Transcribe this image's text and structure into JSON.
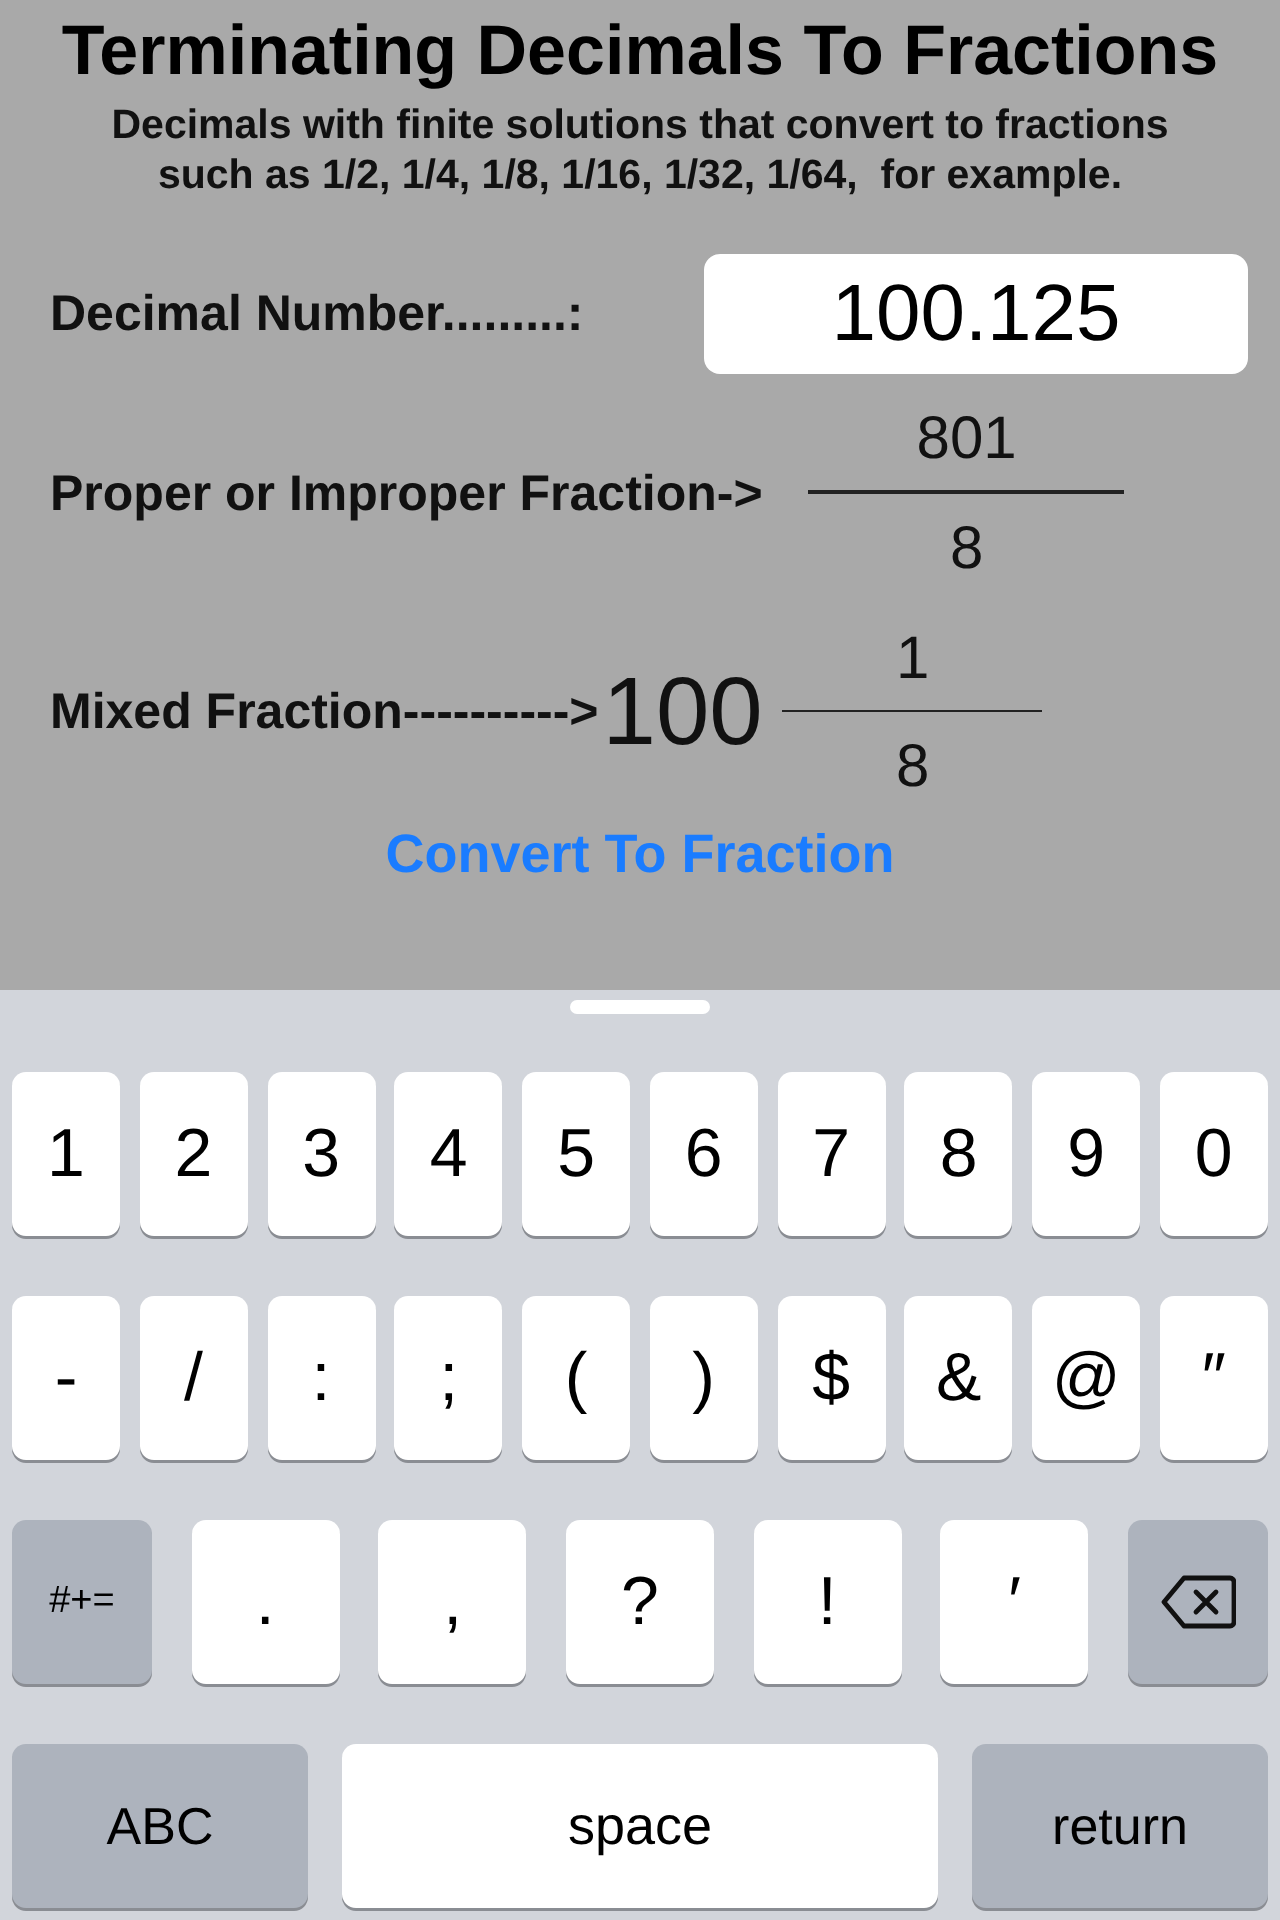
{
  "title": "Terminating Decimals To Fractions",
  "subtitle": [
    "Decimals with finite solutions that convert to fractions",
    "such as 1/2, 1/4, 1/8, 1/16, 1/32, 1/64,  for example."
  ],
  "decimal": {
    "label": "Decimal Number.........:",
    "value": "100.125"
  },
  "improper": {
    "label": "Proper or Improper Fraction->",
    "numerator": "801",
    "denominator": "8"
  },
  "mixed": {
    "label": "Mixed Fraction---------->",
    "whole": "100",
    "numerator": "1",
    "denominator": "8"
  },
  "convert_button": "Convert To Fraction",
  "keyboard": {
    "number_row": [
      {
        "kind": "char",
        "label": "1"
      },
      {
        "kind": "char",
        "label": "2"
      },
      {
        "kind": "char",
        "label": "3"
      },
      {
        "kind": "char",
        "label": "4"
      },
      {
        "kind": "char",
        "label": "5"
      },
      {
        "kind": "char",
        "label": "6"
      },
      {
        "kind": "char",
        "label": "7"
      },
      {
        "kind": "char",
        "label": "8"
      },
      {
        "kind": "char",
        "label": "9"
      },
      {
        "kind": "char",
        "label": "0"
      }
    ],
    "symbol_row": [
      {
        "kind": "char",
        "label": "-"
      },
      {
        "kind": "char",
        "label": "/"
      },
      {
        "kind": "char",
        "label": ":"
      },
      {
        "kind": "char",
        "label": ";"
      },
      {
        "kind": "char",
        "label": "("
      },
      {
        "kind": "char",
        "label": ")"
      },
      {
        "kind": "char",
        "label": "$"
      },
      {
        "kind": "char",
        "label": "&"
      },
      {
        "kind": "char",
        "label": "@"
      },
      {
        "kind": "char",
        "label": "″"
      }
    ],
    "punctuation_row": [
      {
        "kind": "function",
        "label": "#+="
      },
      {
        "kind": "char",
        "label": "."
      },
      {
        "kind": "char",
        "label": ","
      },
      {
        "kind": "char",
        "label": "?"
      },
      {
        "kind": "char",
        "label": "!"
      },
      {
        "kind": "char",
        "label": "′"
      },
      {
        "kind": "backspace"
      }
    ],
    "bottom_row": [
      {
        "kind": "wide-function",
        "label": "ABC"
      },
      {
        "kind": "space",
        "label": "space"
      },
      {
        "kind": "wide-function",
        "label": "return"
      }
    ]
  }
}
